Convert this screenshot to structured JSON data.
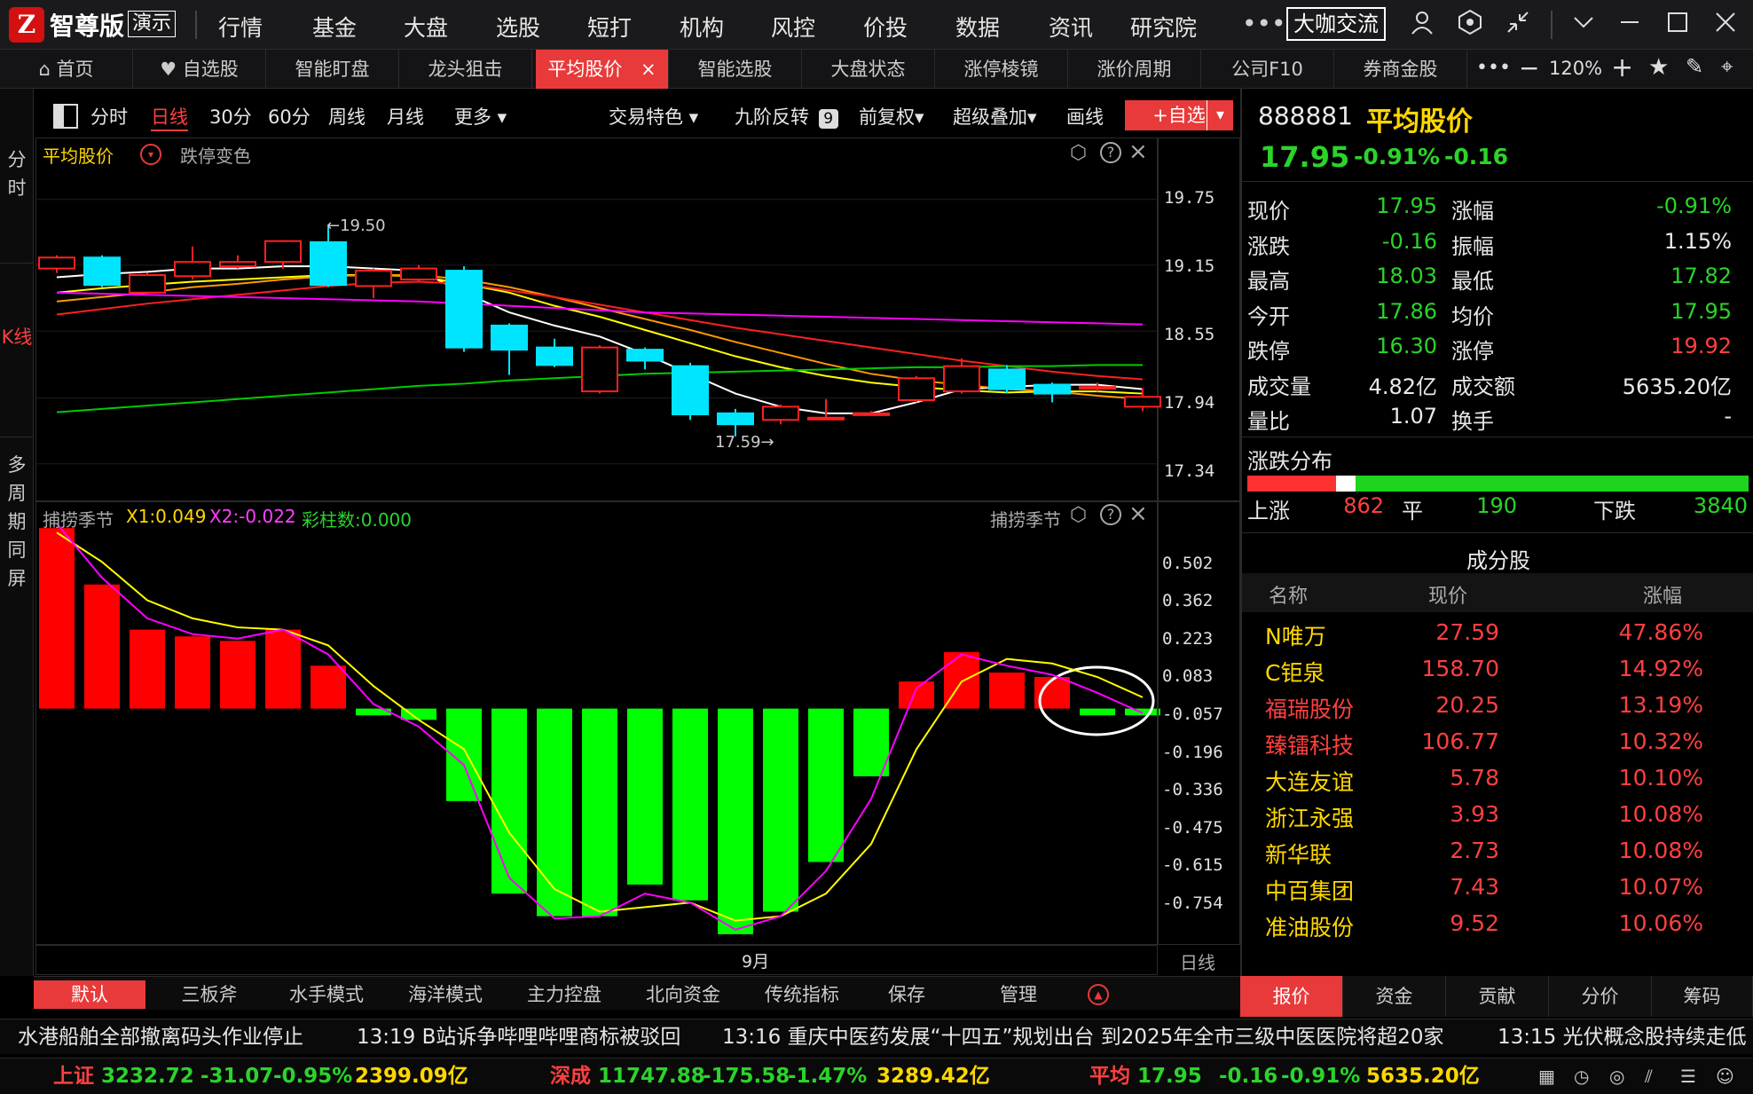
{
  "app": {
    "name": "智尊版",
    "demo_badge": "演示",
    "cafe_button": "大咖交流"
  },
  "top_menu": [
    "行情",
    "基金",
    "大盘",
    "选股",
    "短打",
    "机构",
    "风控",
    "价投",
    "数据",
    "资讯",
    "研究院"
  ],
  "tabs": [
    "首页",
    "自选股",
    "智能盯盘",
    "龙头狙击",
    "平均股价",
    "智能选股",
    "大盘状态",
    "涨停棱镜",
    "涨价周期",
    "公司F10",
    "券商金股"
  ],
  "zoom": "120%",
  "left_nav": {
    "minute": "分时",
    "kline": "K线",
    "multi": "多周期同屏"
  },
  "periods": [
    "分时",
    "日线",
    "30分",
    "60分",
    "周线",
    "月线",
    "更多"
  ],
  "chart_tools": {
    "trade_feature": "交易特色",
    "nine_reverse": "九阶反转",
    "nine_badge": "9",
    "adjust": "前复权",
    "overlay": "超级叠加",
    "draw": "画线",
    "add_watch": "+自选"
  },
  "price_pane": {
    "title": "平均股价",
    "limit_color": "跌停变色",
    "high_mark": "←19.50",
    "low_mark": "17.59→",
    "y_ticks": [
      "19.75",
      "19.15",
      "18.55",
      "17.94",
      "17.34"
    ]
  },
  "indicator_pane": {
    "name": "捕捞季节",
    "x1": "X1:0.049",
    "x2": "X2:-0.022",
    "bars": "彩柱数:0.000",
    "y_ticks": [
      "0.502",
      "0.362",
      "0.223",
      "0.083",
      "-0.057",
      "-0.196",
      "-0.336",
      "-0.475",
      "-0.615",
      "-0.754"
    ]
  },
  "x_axis": {
    "month": "9月",
    "period": "日线"
  },
  "colors": {
    "up": "#ff2020",
    "down": "#00e5ff",
    "macd_up": "#ff0000",
    "macd_down": "#00ff00",
    "ma5": "#ffffff",
    "ma10": "#ffff00",
    "ma20": "#ff9900",
    "ma30": "#ff2020",
    "ma60": "#ff00ff",
    "ma120": "#00cc00",
    "accent": "#e83a3a"
  },
  "chart_data": {
    "type": "candlestick",
    "candles": [
      {
        "open": 19.12,
        "close": 19.22,
        "high": 19.24,
        "low": 19.08
      },
      {
        "open": 19.22,
        "close": 18.97,
        "high": 19.24,
        "low": 18.95
      },
      {
        "open": 18.9,
        "close": 19.06,
        "high": 19.08,
        "low": 18.88
      },
      {
        "open": 19.05,
        "close": 19.18,
        "high": 19.32,
        "low": 19.02
      },
      {
        "open": 19.14,
        "close": 19.18,
        "high": 19.24,
        "low": 19.12
      },
      {
        "open": 19.18,
        "close": 19.37,
        "high": 19.38,
        "low": 19.12
      },
      {
        "open": 19.36,
        "close": 18.97,
        "high": 19.5,
        "low": 18.95
      },
      {
        "open": 18.96,
        "close": 19.1,
        "high": 19.12,
        "low": 18.85
      },
      {
        "open": 19.02,
        "close": 19.12,
        "high": 19.15,
        "low": 19.0
      },
      {
        "open": 19.1,
        "close": 18.4,
        "high": 19.14,
        "low": 18.36
      },
      {
        "open": 18.6,
        "close": 18.38,
        "high": 18.62,
        "low": 18.15
      },
      {
        "open": 18.4,
        "close": 18.24,
        "high": 18.48,
        "low": 18.22
      },
      {
        "open": 18.0,
        "close": 18.4,
        "high": 18.42,
        "low": 17.98
      },
      {
        "open": 18.38,
        "close": 18.28,
        "high": 18.4,
        "low": 18.2
      },
      {
        "open": 18.23,
        "close": 17.79,
        "high": 18.26,
        "low": 17.74
      },
      {
        "open": 17.8,
        "close": 17.7,
        "high": 17.84,
        "low": 17.59
      },
      {
        "open": 17.74,
        "close": 17.86,
        "high": 17.88,
        "low": 17.7
      },
      {
        "open": 17.76,
        "close": 17.76,
        "high": 17.93,
        "low": 17.74
      },
      {
        "open": 17.8,
        "close": 17.8,
        "high": 17.82,
        "low": 17.78
      },
      {
        "open": 17.92,
        "close": 18.12,
        "high": 18.14,
        "low": 17.9
      },
      {
        "open": 18.0,
        "close": 18.23,
        "high": 18.3,
        "low": 17.98
      },
      {
        "open": 18.2,
        "close": 18.02,
        "high": 18.24,
        "low": 17.98
      },
      {
        "open": 18.06,
        "close": 17.98,
        "high": 18.08,
        "low": 17.9
      },
      {
        "open": 18.04,
        "close": 18.04,
        "high": 18.08,
        "low": 18.0
      },
      {
        "open": 17.86,
        "close": 17.95,
        "high": 18.03,
        "low": 17.82
      }
    ],
    "ma_lines": [
      {
        "name": "MA5",
        "values": [
          19.04,
          19.07,
          19.09,
          19.12,
          19.12,
          19.14,
          19.14,
          19.12,
          19.1,
          18.9,
          18.72,
          18.6,
          18.5,
          18.34,
          18.16,
          17.98,
          17.86,
          17.8,
          17.8,
          17.9,
          18.02,
          18.04,
          18.06,
          18.06,
          18.02
        ]
      },
      {
        "name": "MA10",
        "values": [
          18.9,
          18.94,
          18.97,
          19.0,
          19.02,
          19.04,
          19.06,
          19.06,
          19.05,
          18.98,
          18.9,
          18.78,
          18.68,
          18.56,
          18.44,
          18.32,
          18.22,
          18.14,
          18.08,
          18.04,
          18.01,
          17.99,
          18.0,
          18.0,
          17.98
        ]
      },
      {
        "name": "MA20",
        "values": [
          18.82,
          18.86,
          18.9,
          18.95,
          18.98,
          19.02,
          19.05,
          19.06,
          19.06,
          19.02,
          18.95,
          18.86,
          18.76,
          18.66,
          18.56,
          18.45,
          18.35,
          18.25,
          18.16,
          18.1,
          18.06,
          18.02,
          18.0,
          17.96,
          17.93
        ]
      },
      {
        "name": "MA30",
        "values": [
          18.7,
          18.75,
          18.8,
          18.84,
          18.88,
          18.92,
          18.96,
          18.99,
          19.0,
          18.98,
          18.92,
          18.86,
          18.79,
          18.72,
          18.65,
          18.58,
          18.52,
          18.46,
          18.4,
          18.34,
          18.28,
          18.23,
          18.18,
          18.14,
          18.11
        ]
      },
      {
        "name": "MA60",
        "values": [
          18.9,
          18.89,
          18.88,
          18.87,
          18.86,
          18.85,
          18.84,
          18.83,
          18.82,
          18.8,
          18.78,
          18.76,
          18.74,
          18.72,
          18.71,
          18.7,
          18.69,
          18.68,
          18.67,
          18.66,
          18.65,
          18.64,
          18.63,
          18.62,
          18.61
        ]
      },
      {
        "name": "MA120",
        "values": [
          17.81,
          17.84,
          17.87,
          17.9,
          17.93,
          17.96,
          17.99,
          18.02,
          18.05,
          18.07,
          18.1,
          18.12,
          18.14,
          18.16,
          18.17,
          18.18,
          18.19,
          18.2,
          18.21,
          18.22,
          18.22,
          18.23,
          18.23,
          18.24,
          18.24
        ]
      }
    ],
    "y_range": [
      17.2,
      19.95
    ],
    "indicator": {
      "bars": [
        0.8,
        0.55,
        0.35,
        0.32,
        0.3,
        0.35,
        0.19,
        -0.03,
        -0.05,
        -0.41,
        -0.82,
        -0.92,
        -0.92,
        -0.78,
        -0.85,
        -1.0,
        -0.9,
        -0.68,
        -0.3,
        0.12,
        0.25,
        0.16,
        0.14,
        -0.03,
        -0.03
      ],
      "x1": [
        0.78,
        0.65,
        0.48,
        0.4,
        0.36,
        0.35,
        0.28,
        0.1,
        -0.05,
        -0.18,
        -0.55,
        -0.8,
        -0.9,
        -0.88,
        -0.86,
        -0.94,
        -0.92,
        -0.82,
        -0.6,
        -0.18,
        0.12,
        0.22,
        0.2,
        0.14,
        0.05
      ],
      "x2": [
        0.82,
        0.58,
        0.4,
        0.33,
        0.31,
        0.35,
        0.24,
        0.02,
        -0.08,
        -0.25,
        -0.75,
        -0.93,
        -0.92,
        -0.82,
        -0.86,
        -0.98,
        -0.92,
        -0.72,
        -0.4,
        0.09,
        0.24,
        0.19,
        0.15,
        0.07,
        -0.02
      ],
      "y_range": [
        -1.02,
        0.84
      ]
    }
  },
  "quote": {
    "code": "888881",
    "name": "平均股价",
    "price": "17.95",
    "change_pct": "-0.91%",
    "change": "-0.16",
    "rows": [
      {
        "l1": "现价",
        "v1": "17.95",
        "c1": "green",
        "l2": "涨幅",
        "v2": "-0.91%",
        "c2": "green"
      },
      {
        "l1": "涨跌",
        "v1": "-0.16",
        "c1": "green",
        "l2": "振幅",
        "v2": "1.15%",
        "c2": "white"
      },
      {
        "l1": "最高",
        "v1": "18.03",
        "c1": "green",
        "l2": "最低",
        "v2": "17.82",
        "c2": "green"
      },
      {
        "l1": "今开",
        "v1": "17.86",
        "c1": "green",
        "l2": "均价",
        "v2": "17.95",
        "c2": "green"
      },
      {
        "l1": "跌停",
        "v1": "16.30",
        "c1": "green",
        "l2": "涨停",
        "v2": "19.92",
        "c2": "red"
      },
      {
        "l1": "成交量",
        "v1": "4.82亿",
        "c1": "white",
        "l2": "成交额",
        "v2": "5635.20亿",
        "c2": "white"
      },
      {
        "l1": "量比",
        "v1": "1.07",
        "c1": "white",
        "l2": "换手",
        "v2": "-",
        "c2": "white"
      }
    ],
    "breadth": {
      "title": "涨跌分布",
      "up_label": "上涨",
      "up": "862",
      "flat_label": "平",
      "flat": "190",
      "down_label": "下跌",
      "down": "3840"
    },
    "constituents": {
      "title": "成分股",
      "headers": [
        "名称",
        "现价",
        "涨幅"
      ],
      "rows": [
        {
          "name": "N唯万",
          "price": "27.59",
          "pct": "47.86%",
          "hl": true
        },
        {
          "name": "C钜泉",
          "price": "158.70",
          "pct": "14.92%",
          "hl": true
        },
        {
          "name": "福瑞股份",
          "price": "20.25",
          "pct": "13.19%",
          "hl": false
        },
        {
          "name": "臻镭科技",
          "price": "106.77",
          "pct": "10.32%",
          "hl": false
        },
        {
          "name": "大连友谊",
          "price": "5.78",
          "pct": "10.10%",
          "hl": true
        },
        {
          "name": "浙江永强",
          "price": "3.93",
          "pct": "10.08%",
          "hl": true
        },
        {
          "name": "新华联",
          "price": "2.73",
          "pct": "10.08%",
          "hl": true
        },
        {
          "name": "中百集团",
          "price": "7.43",
          "pct": "10.07%",
          "hl": true
        },
        {
          "name": "准油股份",
          "price": "9.52",
          "pct": "10.06%",
          "hl": true
        }
      ]
    },
    "bottom_tabs": [
      "报价",
      "资金",
      "贡献",
      "分价",
      "筹码"
    ]
  },
  "mode_bar": [
    "默认",
    "三板斧",
    "水手模式",
    "海洋模式",
    "主力控盘",
    "北向资金",
    "传统指标",
    "保存",
    "管理"
  ],
  "news": [
    "水港船舶全部撤离码头作业停止",
    "13:19 B站诉争哔哩哔哩商标被驳回",
    "13:16 重庆中医药发展“十四五”规划出台 到2025年全市三级中医医院将超20家",
    "13:15 光伏概念股持续走低"
  ],
  "indices": [
    {
      "name": "上证",
      "value": "3232.72",
      "chg": "-31.07",
      "pct": "-0.95%",
      "amt": "2399.09亿"
    },
    {
      "name": "深成",
      "value": "11747.88",
      "chg": "-175.58",
      "pct": "-1.47%",
      "amt": "3289.42亿"
    },
    {
      "name": "平均",
      "value": "17.95",
      "chg": "-0.16",
      "pct": "-0.91%",
      "amt": "5635.20亿"
    }
  ]
}
